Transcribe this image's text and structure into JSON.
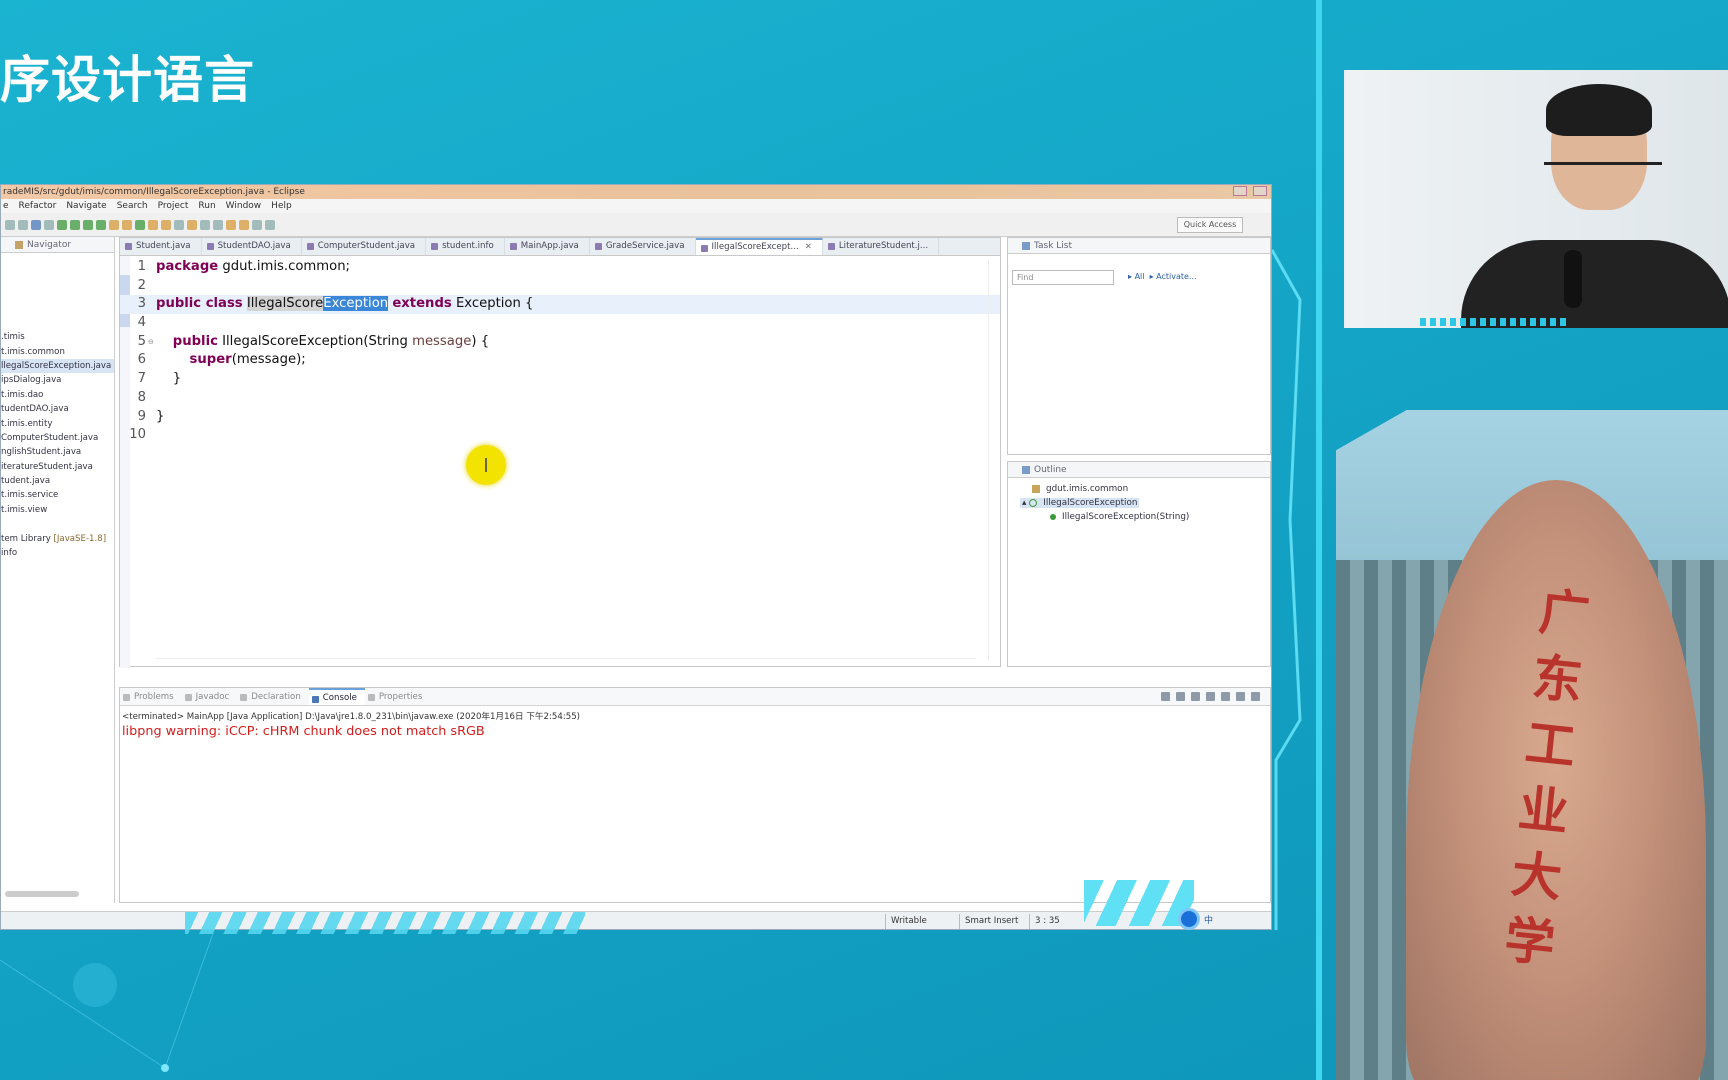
{
  "slide": {
    "title": "序设计语言"
  },
  "presenter": {
    "campus_text": "广东工业大学"
  },
  "eclipse": {
    "window_title": "radeMIS/src/gdut/imis/common/IllegalScoreException.java - Eclipse",
    "menu": [
      "e",
      "Refactor",
      "Navigate",
      "Search",
      "Project",
      "Run",
      "Window",
      "Help"
    ],
    "quick_access": "Quick Access",
    "navigator": {
      "title": "Navigator",
      "items": [
        {
          "label": "",
          "type": "gap"
        },
        {
          "label": "",
          "type": "gap"
        },
        {
          "label": "",
          "type": "gap"
        },
        {
          "label": ".timis",
          "type": "pkg"
        },
        {
          "label": "t.imis.common",
          "type": "pkg"
        },
        {
          "label": "llegalScoreException.java",
          "type": "file",
          "selected": true
        },
        {
          "label": "ipsDialog.java",
          "type": "file"
        },
        {
          "label": "t.imis.dao",
          "type": "pkg"
        },
        {
          "label": "tudentDAO.java",
          "type": "file"
        },
        {
          "label": "t.imis.entity",
          "type": "pkg"
        },
        {
          "label": "ComputerStudent.java",
          "type": "file"
        },
        {
          "label": "nglishStudent.java",
          "type": "file"
        },
        {
          "label": "iteratureStudent.java",
          "type": "file"
        },
        {
          "label": "tudent.java",
          "type": "file"
        },
        {
          "label": "t.imis.service",
          "type": "pkg"
        },
        {
          "label": "t.imis.view",
          "type": "pkg"
        },
        {
          "label": "",
          "type": "gap"
        },
        {
          "label": "tem Library",
          "suffix": "[JavaSE-1.8]",
          "type": "lib"
        },
        {
          "label": "info",
          "type": "file"
        }
      ]
    },
    "editor_tabs": [
      {
        "label": "Student.java"
      },
      {
        "label": "StudentDAO.java"
      },
      {
        "label": "ComputerStudent.java"
      },
      {
        "label": "student.info"
      },
      {
        "label": "MainApp.java"
      },
      {
        "label": "GradeService.java"
      },
      {
        "label": "IllegalScoreExcept...",
        "active": true
      },
      {
        "label": "LiteratureStudent.j..."
      }
    ],
    "code": {
      "line_numbers": [
        "1",
        "2",
        "3",
        "4",
        "5",
        "6",
        "7",
        "8",
        "9",
        "10"
      ],
      "l1_kw": "package",
      "l1_rest": " gdut.imis.common;",
      "l3_kw": "public class",
      "l3_name_a": "IllegalScore",
      "l3_name_b": "Exception",
      "l3_kw2": "extends",
      "l3_rest": " Exception {",
      "l5_kw": "public",
      "l5_a": " IllegalScoreException(String ",
      "l5_param": "message",
      "l5_b": ") {",
      "l6_kw": "super",
      "l6_a": "(message);",
      "l7": "}",
      "l9": "}"
    },
    "task_list": {
      "title": "Task List",
      "find_placeholder": "Find",
      "all_label": "All",
      "activate_label": "Activate..."
    },
    "outline": {
      "title": "Outline",
      "package": "gdut.imis.common",
      "class": "IllegalScoreException",
      "method": "IllegalScoreException(String)"
    },
    "bottom_tabs": [
      {
        "label": "Problems"
      },
      {
        "label": "Javadoc"
      },
      {
        "label": "Declaration"
      },
      {
        "label": "Console",
        "active": true
      },
      {
        "label": "Properties"
      }
    ],
    "console": {
      "terminated": "<terminated> MainApp [Java Application] D:\\Java\\jre1.8.0_231\\bin\\javaw.exe (2020年1月16日 下午2:54:55)",
      "warning": "libpng warning: iCCP: cHRM chunk does not match sRGB"
    },
    "status": {
      "writable": "Writable",
      "insert": "Smart Insert",
      "position": "3 : 35"
    },
    "ime": "中"
  }
}
